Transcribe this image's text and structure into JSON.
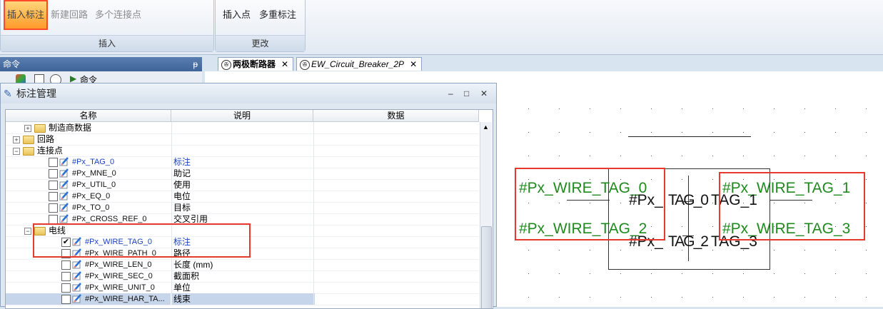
{
  "ribbon": {
    "insert_group": {
      "buttons": [
        "插入标注",
        "新建回路",
        "多个连接点"
      ],
      "label": "插入"
    },
    "modify_group": {
      "buttons": [
        "插入点",
        "多重标注"
      ],
      "label": "更改"
    }
  },
  "command_panel": {
    "title": "命令",
    "pin": "ᵽ",
    "tab_label": "命令"
  },
  "doc_tabs": [
    {
      "label": "两极断路器",
      "close": "✕"
    },
    {
      "label": "EW_Circuit_Breaker_2P",
      "close": "✕"
    }
  ],
  "dialog": {
    "title": "标注管理",
    "min": "–",
    "max": "□",
    "close": "✕",
    "columns": [
      "名称",
      "说明",
      "数据"
    ],
    "rows": [
      {
        "name": "制造商数据",
        "desc": ""
      },
      {
        "name": "回路",
        "desc": ""
      },
      {
        "name": "连接点",
        "desc": ""
      },
      {
        "name": "#Px_TAG_0",
        "desc": "标注"
      },
      {
        "name": "#Px_MNE_0",
        "desc": "助记"
      },
      {
        "name": "#Px_UTIL_0",
        "desc": "使用"
      },
      {
        "name": "#Px_EQ_0",
        "desc": "电位"
      },
      {
        "name": "#Px_TO_0",
        "desc": "目标"
      },
      {
        "name": "#Px_CROSS_REF_0",
        "desc": "交叉引用"
      },
      {
        "name": "电线",
        "desc": ""
      },
      {
        "name": "#Px_WIRE_TAG_0",
        "desc": "标注"
      },
      {
        "name": "#Px_WIRE_PATH_0",
        "desc": "路径"
      },
      {
        "name": "#Px_WIRE_LEN_0",
        "desc": "长度 (mm)"
      },
      {
        "name": "#Px_WIRE_SEC_0",
        "desc": "截面积"
      },
      {
        "name": "#Px_WIRE_UNIT_0",
        "desc": "单位"
      },
      {
        "name": "#Px_WIRE_HAR_TA...",
        "desc": "线束"
      }
    ]
  },
  "canvas": {
    "green_tags": [
      "#Px_WIRE_TAG_0",
      "#Px_WIRE_TAG_2",
      "#Px_WIRE_TAG_1",
      "#Px_WIRE_TAG_3"
    ],
    "overlap_top_a": "#Px_",
    "overlap_top_b": "TAG_0",
    "overlap_top_c": "TAG_1",
    "overlap_bot_a": "#Px_",
    "overlap_bot_b": "TAG_2",
    "overlap_bot_c": "TAG_3"
  },
  "colors": {
    "highlight": "#e8392e",
    "tag_green": "#1e8a1e",
    "link_blue": "#1a3fbf"
  }
}
